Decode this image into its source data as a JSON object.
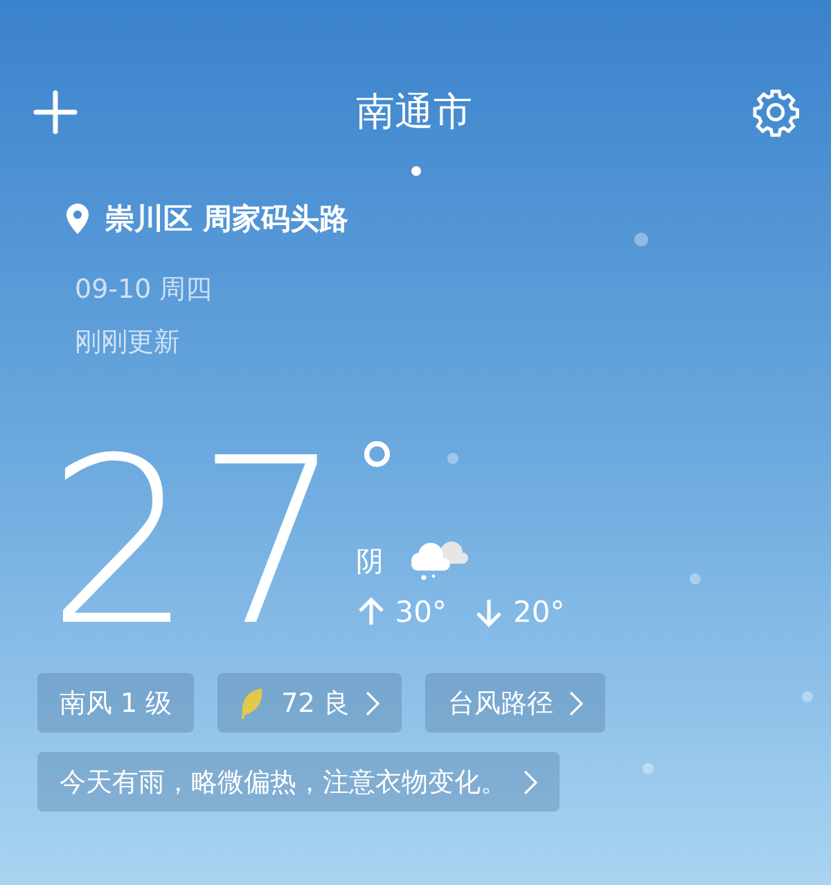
{
  "header": {
    "title": "南通市"
  },
  "location": "崇川区 周家码头路",
  "date": "09-10  周四",
  "updated": "刚刚更新",
  "current": {
    "temp": "27",
    "unit": "°",
    "condition": "阴",
    "high": "30°",
    "low": "20°"
  },
  "chips": [
    {
      "kind": "plain",
      "label": "南风 1 级"
    },
    {
      "kind": "aqi",
      "label": "72 良"
    },
    {
      "kind": "link",
      "label": "台风路径"
    }
  ],
  "tip": "今天有雨，略微偏热，注意衣物变化。"
}
